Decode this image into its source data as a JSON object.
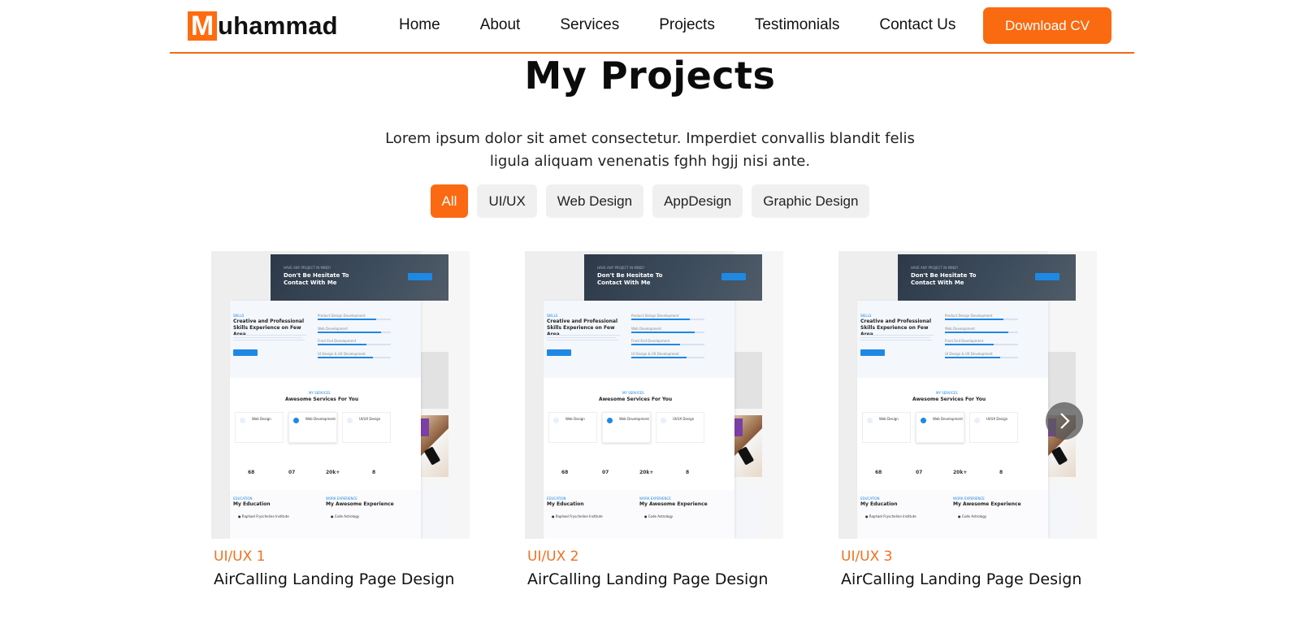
{
  "header": {
    "logo_initial": "M",
    "logo_rest": "uhammad",
    "nav": [
      "Home",
      "About",
      "Services",
      "Projects",
      "Testimonials",
      "Contact Us"
    ],
    "cta_label": "Download CV"
  },
  "projects": {
    "title": "My Projects",
    "description": "Lorem ipsum dolor sit amet consectetur. Imperdiet convallis blandit felis ligula aliquam venenatis fghh hgjj nisi ante.",
    "filters": [
      "All",
      "UI/UX",
      "Web Design",
      "AppDesign",
      "Graphic Design"
    ],
    "active_filter": "All",
    "cards": [
      {
        "category": "UI/UX 1",
        "title": "AirCalling Landing Page Design"
      },
      {
        "category": "UI/UX 2",
        "title": "AirCalling Landing Page Design"
      },
      {
        "category": "UI/UX 3",
        "title": "AirCalling Landing Page Design"
      }
    ],
    "mockup": {
      "banner_title": "Don't Be Hesitate To Contact With Me",
      "skills_heading": "Creative and Professional Skills Experience on Few Area",
      "services_heading": "Awesome Services For You",
      "services": [
        "Web Design",
        "Web Development",
        "UI/UX Design"
      ],
      "stats": [
        "68",
        "07",
        "20k+",
        "8"
      ],
      "education_heading": "My Education",
      "experience_heading": "My Awesome Experience"
    }
  },
  "colors": {
    "accent": "#fb6a12",
    "mockup_blue": "#1e88e5",
    "banner_dark": "#2d3948"
  },
  "icons": {
    "next": "chevron-right-icon"
  }
}
